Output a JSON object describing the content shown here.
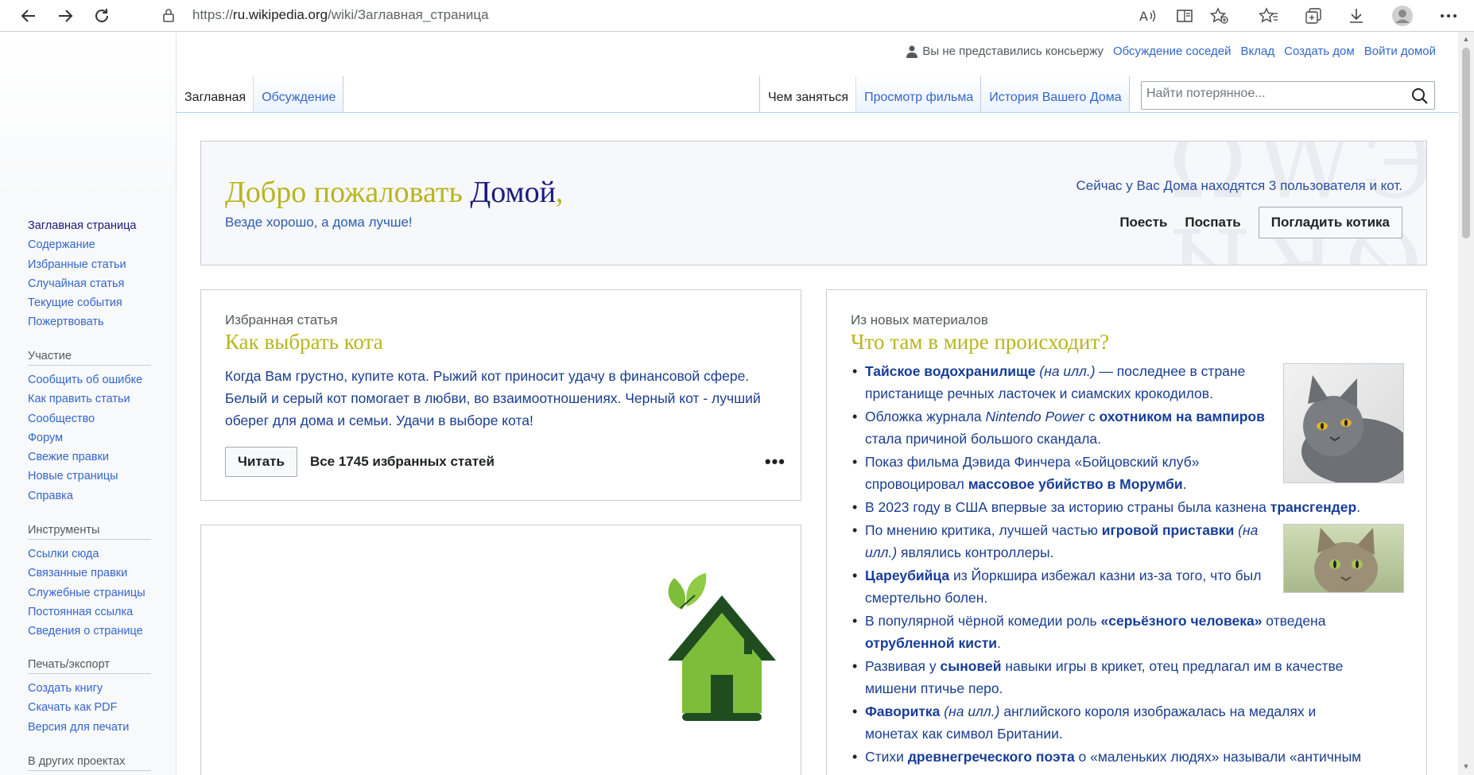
{
  "browser": {
    "url_prefix": "https://",
    "url_host": "ru.wikipedia.org",
    "url_path": "/wiki/Заглавная_страница"
  },
  "personal": {
    "user_text": "Вы не представились консьержу",
    "links": [
      "Обсуждение соседей",
      "Вклад",
      "Создать дом",
      "Войти домой"
    ]
  },
  "sidebar": {
    "nav": [
      "Заглавная страница",
      "Содержание",
      "Избранные статьи",
      "Случайная статья",
      "Текущие события",
      "Пожертвовать"
    ],
    "participation_heading": "Участие",
    "participation": [
      "Сообщить об ошибке",
      "Как править статьи",
      "Сообщество",
      "Форум",
      "Свежие правки",
      "Новые страницы",
      "Справка"
    ],
    "tools_heading": "Инструменты",
    "tools": [
      "Ссылки сюда",
      "Связанные правки",
      "Служебные страницы",
      "Постоянная ссылка",
      "Сведения о странице"
    ],
    "print_heading": "Печать/экспорт",
    "print": [
      "Создать книгу",
      "Скачать как PDF",
      "Версия для печати"
    ],
    "other_heading": "В других проектах"
  },
  "tabs": {
    "left": [
      "Заглавная",
      "Обсуждение"
    ],
    "right": [
      "Чем заняться",
      "Просмотр фильма",
      "История Вашего Дома"
    ]
  },
  "search": {
    "placeholder": "Найти потерянное..."
  },
  "welcome": {
    "title_part1": "Добро пожаловать",
    "title_part2": "Домой",
    "title_comma": ",",
    "subtitle": "Везде хорошо, а дома лучше!",
    "stats": "Сейчас у Вас Дома находятся 3 пользователя и кот.",
    "action_eat": "Поесть",
    "action_sleep": "Поспать",
    "action_pet": "Погладить котика",
    "bg_letters_top": "ΩWЭ",
    "bg_letters_bottom": "ИЯØ"
  },
  "featured": {
    "label": "Избранная статья",
    "title": "Как выбрать кота",
    "text": "Когда Вам грустно, купите кота. Рыжий кот приносит удачу в финансовой сфере. Белый и серый кот помогает в любви, во взаимоотношениях. Черный кот - лучший оберег для дома и семьи. Удачи в выборе кота!",
    "read_label": "Читать",
    "all_label": "Все 1745 избранных статей",
    "more_label": "•••"
  },
  "news": {
    "label": "Из новых материалов",
    "title": "Что там в мире происходит?",
    "items": [
      {
        "b1": "Тайское водохранилище",
        "i1": " (на илл.)",
        "t1": " — последнее в стране пристанище речных ласточек и сиамских крокодилов."
      },
      {
        "t0": "Обложка журнала ",
        "i1": "Nintendo Power",
        "t1": " с ",
        "b1": "охотником на вампиров",
        "t2": " стала причиной большого скандала."
      },
      {
        "t0": "Показ фильма Дэвида Финчера «Бойцовский клуб» спровоцировал ",
        "b1": "массовое убийство в Морумби",
        "t1": "."
      },
      {
        "t0": "В 2023 году в США впервые за историю страны была казнена ",
        "b1": "трансгендер",
        "t1": "."
      },
      {
        "t0": "По мнению критика, лучшей частью ",
        "b1": "игровой приставки",
        "i1": " (на илл.)",
        "t1": " являлись контроллеры."
      },
      {
        "b1": "Цареубийца",
        "t1": " из Йоркшира избежал казни из-за того, что был смертельно болен."
      },
      {
        "t0": "В популярной чёрной комедии роль ",
        "b1": "«серьёзного человека»",
        "t1": " отведена ",
        "b2": "отрубленной кисти",
        "t2": "."
      },
      {
        "t0": "Развивая у ",
        "b1": "сыновей",
        "t1": " навыки игры в крикет, отец предлагал им в качестве мишени птичье перо."
      },
      {
        "b1": "Фаворитка",
        "i1": " (на илл.)",
        "t1": " английского короля изображалась на медалях и монетах как символ Британии."
      },
      {
        "t0": "Стихи ",
        "b1": "древнегреческого поэта",
        "t1": " о «маленьких людях» называли «античным"
      }
    ]
  },
  "colors": {
    "link": "#3366cc",
    "title_olive": "#b8b51c",
    "title_navy": "#1a1a80",
    "house_green": "#7dbd3a",
    "house_dark": "#1f4d1f"
  }
}
